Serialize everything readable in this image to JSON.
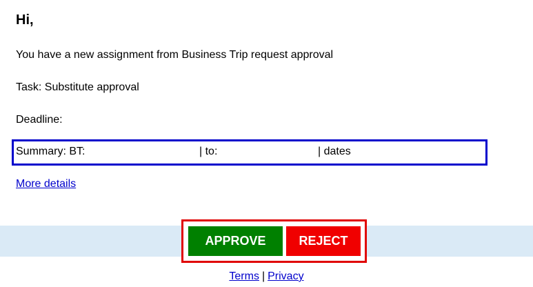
{
  "email": {
    "greeting": "Hi,",
    "intro": "You have a new assignment from Business Trip request approval",
    "task": "Task: Substitute approval",
    "deadline": "Deadline:",
    "summary": {
      "label": "Summary: BT:",
      "to": "| to:",
      "dates": "| dates"
    },
    "more_details_label": "More details"
  },
  "actions": {
    "approve_label": "APPROVE",
    "reject_label": "REJECT"
  },
  "footer": {
    "terms_label": "Terms",
    "separator": "|",
    "privacy_label": "Privacy"
  },
  "colors": {
    "approve": "#008000",
    "reject": "#f00000",
    "summary_border": "#0000cc",
    "buttons_border": "#e00000",
    "band": "#daeaf6",
    "link": "#0000cc"
  }
}
